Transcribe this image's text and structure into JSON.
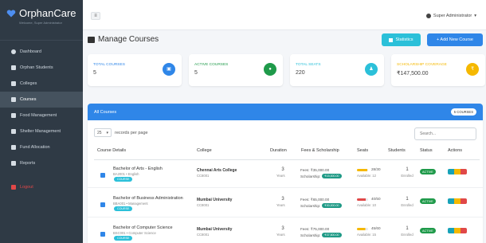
{
  "brand": {
    "title": "OrphanCare",
    "subtitle": "Welcome, Super Administrator"
  },
  "sidebar": {
    "items": [
      {
        "label": "Dashboard"
      },
      {
        "label": "Orphan Students"
      },
      {
        "label": "Colleges"
      },
      {
        "label": "Courses"
      },
      {
        "label": "Food Management"
      },
      {
        "label": "Shelter Management"
      },
      {
        "label": "Fund Allocation"
      },
      {
        "label": "Reports"
      }
    ],
    "logout": "Logout"
  },
  "topbar": {
    "toggle": "≡",
    "user": "Super Administrator"
  },
  "page": {
    "title": "Manage Courses",
    "stats_label": "Statistics",
    "add_label": "+ Add New Course"
  },
  "stats": [
    {
      "label": "TOTAL COURSES",
      "value": "5",
      "color": "#2f86e8"
    },
    {
      "label": "ACTIVE COURSES",
      "value": "5",
      "color": "#1f9a4a"
    },
    {
      "label": "TOTAL SEATS",
      "value": "220",
      "color": "#2bc0d9"
    },
    {
      "label": "SCHOLARSHIP COVERAGE",
      "value": "₹147,500.00",
      "color": "#f5b800"
    }
  ],
  "table": {
    "header": "All Courses",
    "count_badge": "5 COURSES",
    "per_page_value": "25",
    "per_page_label": "records per page",
    "search_placeholder": "Search...",
    "columns": [
      "Course Details",
      "College",
      "Duration",
      "Fees & Scholarship",
      "Seats",
      "Students",
      "Status",
      "Actions"
    ],
    "rows": [
      {
        "name": "Bachelor of Arts - English",
        "sub": "BA2001 • English",
        "tag": "COURSE",
        "college": "Chennai Arts College",
        "code": "CC8001",
        "duration": "3",
        "unit": "Years",
        "fee": "Fees: ₹35,000.00",
        "scholarship": "Scholarship:",
        "scholarship_amt": "₹15,000.00",
        "seats": "28/30",
        "available": "Available: 12",
        "seat_color": "#f5b800",
        "seat_fill": 0.93,
        "students": "1",
        "enrolled": "Enrolled",
        "status": "ACTIVE"
      },
      {
        "name": "Bachelor of Business Administration",
        "sub": "BBA001 • Management",
        "tag": "COURSE",
        "college": "Mumbai University",
        "code": "CC8001",
        "duration": "3",
        "unit": "Years",
        "fee": "Fees: ₹65,000.00",
        "scholarship": "Scholarship:",
        "scholarship_amt": "₹30,000.00",
        "seats": "40/50",
        "available": "Available: 10",
        "seat_color": "#e04848",
        "seat_fill": 0.8,
        "students": "1",
        "enrolled": "Enrolled",
        "status": "ACTIVE"
      },
      {
        "name": "Bachelor of Computer Science",
        "sub": "BSC001 • Computer Science",
        "tag": "COURSE",
        "college": "Mumbai University",
        "code": "CC8001",
        "duration": "3",
        "unit": "Years",
        "fee": "Fees: ₹75,000.00",
        "scholarship": "Scholarship:",
        "scholarship_amt": "₹37,500.00",
        "seats": "45/60",
        "available": "Available: 15",
        "seat_color": "#f5b800",
        "seat_fill": 0.75,
        "students": "1",
        "enrolled": "Enrolled",
        "status": "ACTIVE"
      }
    ]
  }
}
